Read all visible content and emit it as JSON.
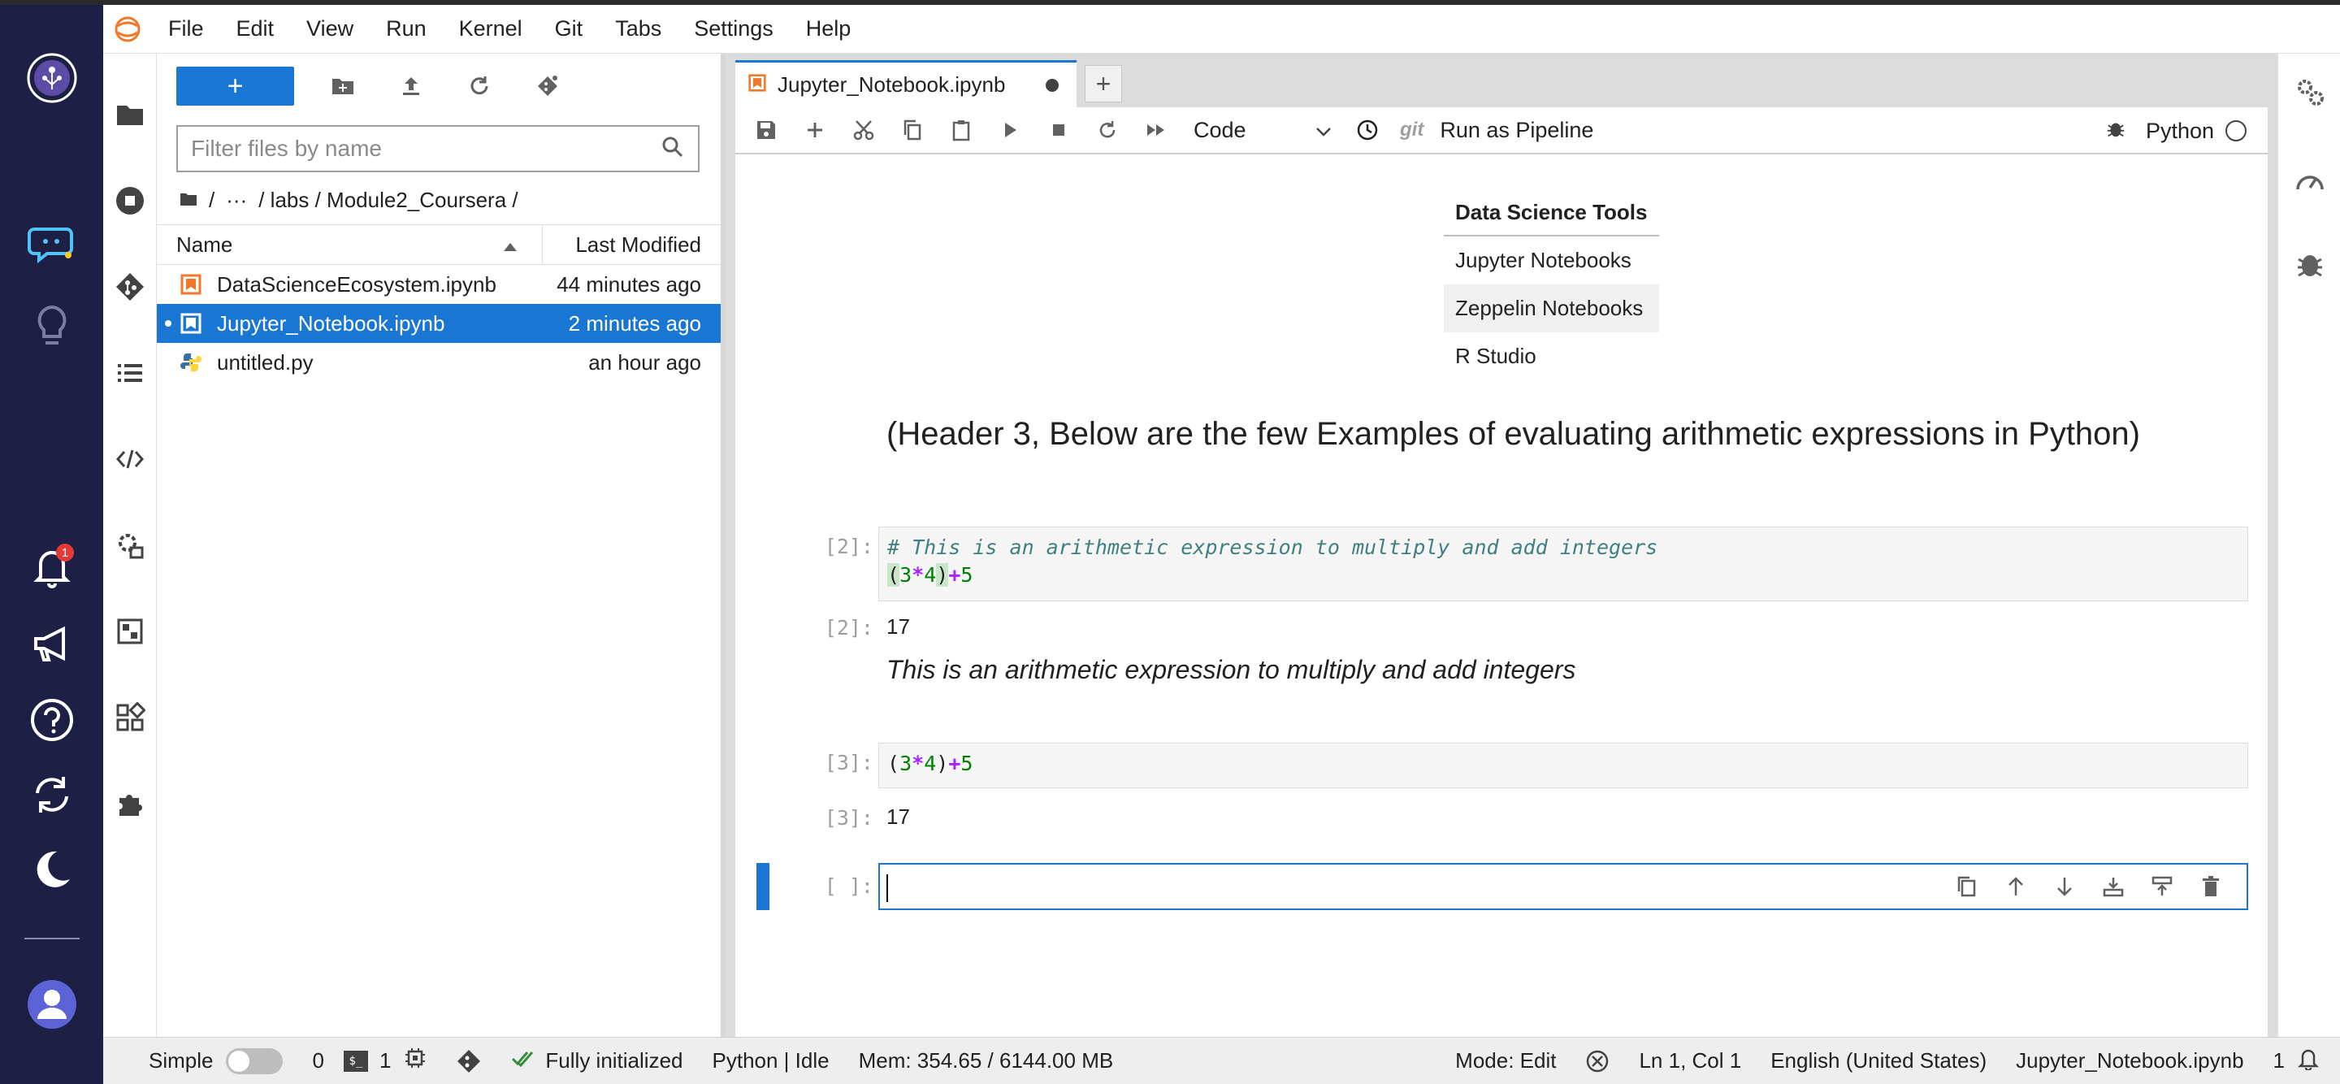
{
  "menubar": {
    "items": [
      "File",
      "Edit",
      "View",
      "Run",
      "Kernel",
      "Git",
      "Tabs",
      "Settings",
      "Help"
    ]
  },
  "rail": {
    "notification_count": "1"
  },
  "filebrowser": {
    "new_label": "+",
    "filter_placeholder": "Filter files by name",
    "breadcrumbs": [
      "/",
      "···",
      "/ labs / Module2_Coursera /"
    ],
    "col_name": "Name",
    "col_modified": "Last Modified",
    "files": [
      {
        "name": "DataScienceEcosystem.ipynb",
        "modified": "44 minutes ago",
        "type": "notebook",
        "selected": false
      },
      {
        "name": "Jupyter_Notebook.ipynb",
        "modified": "2 minutes ago",
        "type": "notebook",
        "selected": true
      },
      {
        "name": "untitled.py",
        "modified": "an hour ago",
        "type": "python",
        "selected": false
      }
    ]
  },
  "tabs": {
    "active_tab": "Jupyter_Notebook.ipynb",
    "add_label": "+"
  },
  "nb_toolbar": {
    "cell_type": "Code",
    "git_label": "git",
    "run_pipeline": "Run as Pipeline",
    "kernel_name": "Python"
  },
  "notebook": {
    "table": {
      "header": "Data Science Tools",
      "rows": [
        "Jupyter Notebooks",
        "Zeppelin Notebooks",
        "R Studio"
      ]
    },
    "h3": "(Header 3, Below are the few Examples of evaluating arithmetic expressions in Python)",
    "cell1": {
      "prompt": "[2]:",
      "comment": "# This is an arithmetic expression to multiply and add integers",
      "out_prompt": "[2]:",
      "output": "17"
    },
    "md_italic": "This is an arithmetic expression to multiply and add integers",
    "cell2": {
      "prompt": "[3]:",
      "out_prompt": "[3]:",
      "output": "17"
    },
    "active": {
      "prompt": "[ ]:"
    }
  },
  "statusbar": {
    "mode_label": "Simple",
    "kernels_count": "0",
    "terminals_count": "1",
    "init_status": "Fully initialized",
    "kernel_status": "Python | Idle",
    "memory": "Mem: 354.65 / 6144.00 MB",
    "edit_mode": "Mode: Edit",
    "cursor": "Ln 1, Col 1",
    "language": "English (United States)",
    "file": "Jupyter_Notebook.ipynb",
    "notif_count": "1"
  },
  "colors": {
    "accent": "#1976d2",
    "rail_bg": "#1e1f45",
    "notebook_icon": "#f37726"
  }
}
